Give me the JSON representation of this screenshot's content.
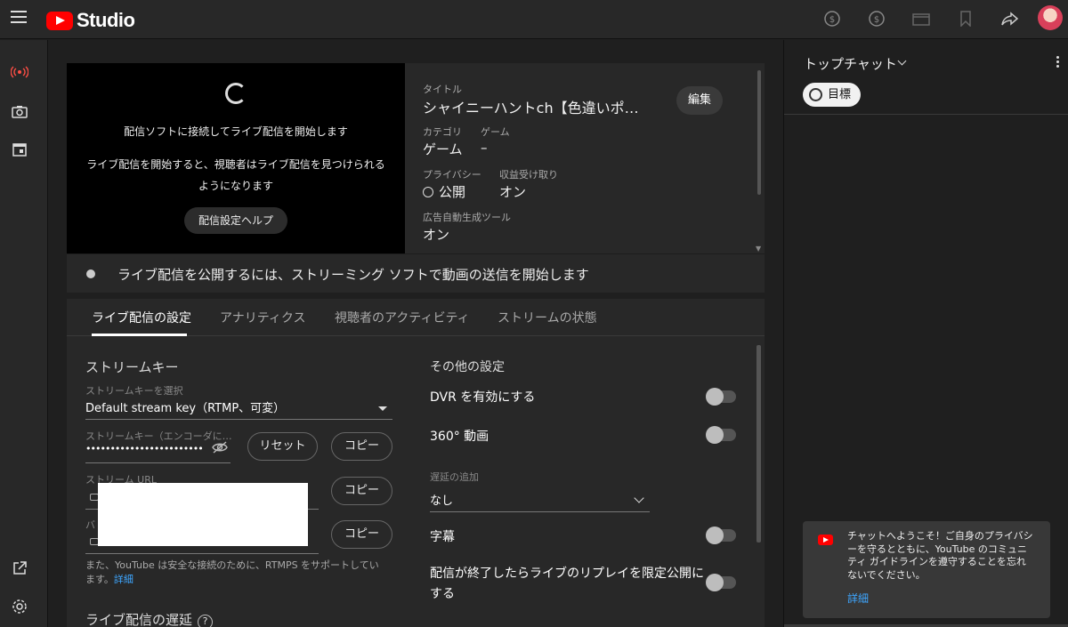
{
  "app": {
    "logo_text": "Studio"
  },
  "topbar": {
    "icons": [
      "create-supers-icon",
      "super-thanks-icon",
      "clapperboard-icon",
      "bookmark-icon",
      "share-icon"
    ]
  },
  "rail": {
    "items": [
      "live-icon",
      "camera-icon",
      "calendar-icon"
    ],
    "bottom": [
      "external-link-icon",
      "settings-icon"
    ]
  },
  "video": {
    "message1": "配信ソフトに接続してライブ配信を開始します",
    "message2": "ライブ配信を開始すると、視聴者はライブ配信を見つけられるようになります",
    "help_button": "配信設定ヘルプ"
  },
  "meta": {
    "title_label": "タイトル",
    "title": "シャイニーハントch【色違いポ…",
    "edit_button": "編集",
    "category_label": "カテゴリ",
    "category": "ゲーム",
    "game_label": "ゲーム",
    "game": "–",
    "privacy_label": "プライバシー",
    "privacy": "公開",
    "monetization_label": "収益受け取り",
    "monetization": "オン",
    "auto_ads_label": "広告自動生成ツール",
    "auto_ads": "オン"
  },
  "status": {
    "text": "ライブ配信を公開するには、ストリーミング ソフトで動画の送信を開始します"
  },
  "tabs": [
    "ライブ配信の設定",
    "アナリティクス",
    "視聴者のアクティビティ",
    "ストリームの状態"
  ],
  "stream": {
    "heading": "ストリームキー",
    "select_label": "ストリームキーを選択",
    "select_value": "Default stream key（RTMP、可変）",
    "key_label": "ストリームキー（エンコーダに…",
    "key_value": "••••••••••••••••••••••••",
    "reset_button": "リセット",
    "copy_button": "コピー",
    "url_label": "ストリーム URL",
    "backup_label": "バ",
    "note": "また、YouTube は安全な接続のために、RTMPS をサポートしています。",
    "note_link": "詳細",
    "latency_heading": "ライブ配信の遅延",
    "latency_help": "?"
  },
  "other": {
    "heading": "その他の設定",
    "dvr": "DVR を有効にする",
    "video360": "360° 動画",
    "delay_label": "遅延の追加",
    "delay_value": "なし",
    "captions": "字幕",
    "replay": "配信が終了したらライブのリプレイを限定公開にする"
  },
  "chat": {
    "title": "トップチャット",
    "goal_button": "目標",
    "welcome": "チャットへようこそ！ご自身のプライバシーを守るとともに、YouTube のコミュニティ ガイドラインを遵守することを忘れないでください。",
    "welcome_link": "詳細"
  },
  "colors": {
    "accent": "#ff0000",
    "link": "#3ea6ff",
    "background": "#1f1f1f",
    "panel": "#282828"
  }
}
